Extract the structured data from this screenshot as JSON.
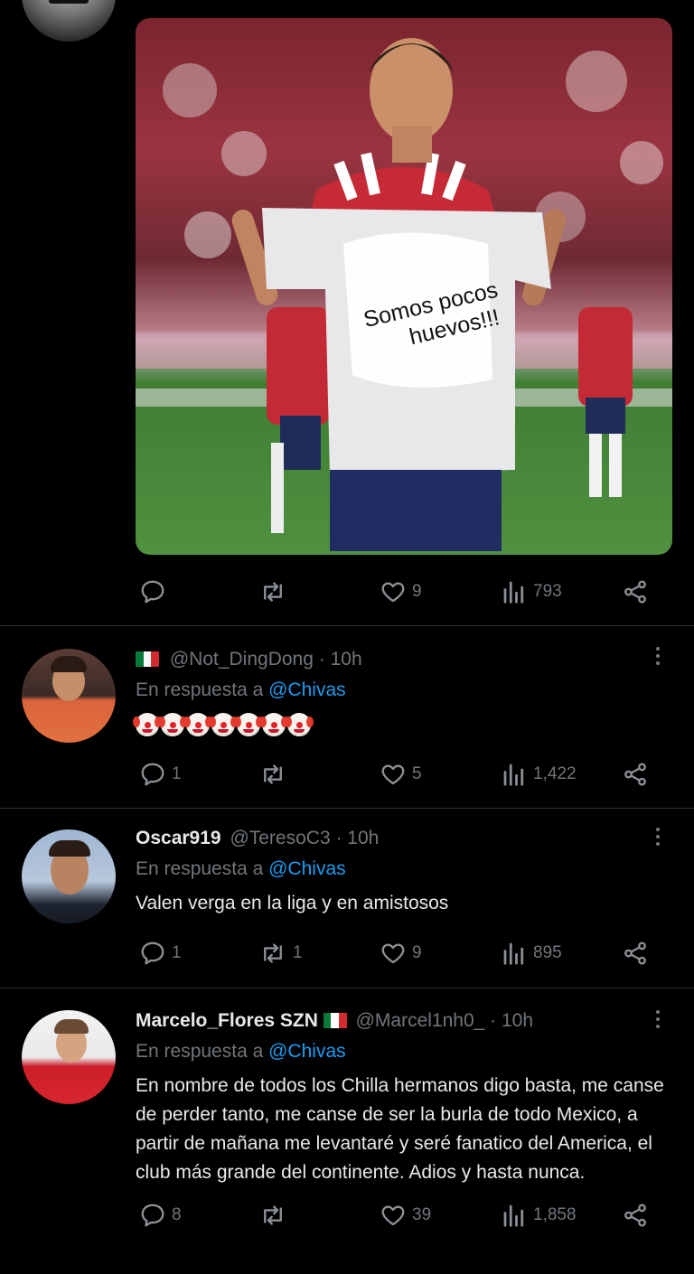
{
  "main_tweet": {
    "shirt_text": [
      "Somos pocos",
      "huevos!!!"
    ],
    "stats": {
      "replies": "",
      "retweets": "",
      "likes": "9",
      "views": "793"
    }
  },
  "replies": [
    {
      "display_name": "",
      "handle": "@Not_DingDong",
      "time": "· 10h",
      "reply_prefix": "En respuesta a",
      "reply_to": "@Chivas",
      "emoji_count": 7,
      "text": "",
      "stats": {
        "replies": "1",
        "retweets": "",
        "likes": "5",
        "views": "1,422"
      }
    },
    {
      "display_name": "Oscar919",
      "handle": "@TeresoC3",
      "time": "· 10h",
      "reply_prefix": "En respuesta a",
      "reply_to": "@Chivas",
      "text": "Valen verga en la liga y en amistosos",
      "stats": {
        "replies": "1",
        "retweets": "1",
        "likes": "9",
        "views": "895"
      }
    },
    {
      "display_name": "Marcelo_Flores SZN",
      "handle": "@Marcel1nh0_",
      "time": "· 10h",
      "reply_prefix": "En respuesta a",
      "reply_to": "@Chivas",
      "text": "En nombre de todos los Chilla hermanos digo basta, me canse de perder tanto, me canse de ser la burla de todo Mexico, a partir de mañana me levantaré y seré fanatico del America, el club más grande del continente. Adios y hasta nunca.",
      "stats": {
        "replies": "8",
        "retweets": "",
        "likes": "39",
        "views": "1,858"
      }
    }
  ],
  "icons": {
    "reply": "speech-bubble-icon",
    "retweet": "retweet-arrows-icon",
    "like": "heart-icon",
    "views": "bar-chart-icon",
    "share": "share-nodes-icon",
    "more": "more-dots-icon"
  },
  "colors": {
    "background": "#000000",
    "text": "#e7e9ea",
    "muted": "#71767b",
    "link": "#1d9bf0",
    "divider": "#2f3336"
  }
}
